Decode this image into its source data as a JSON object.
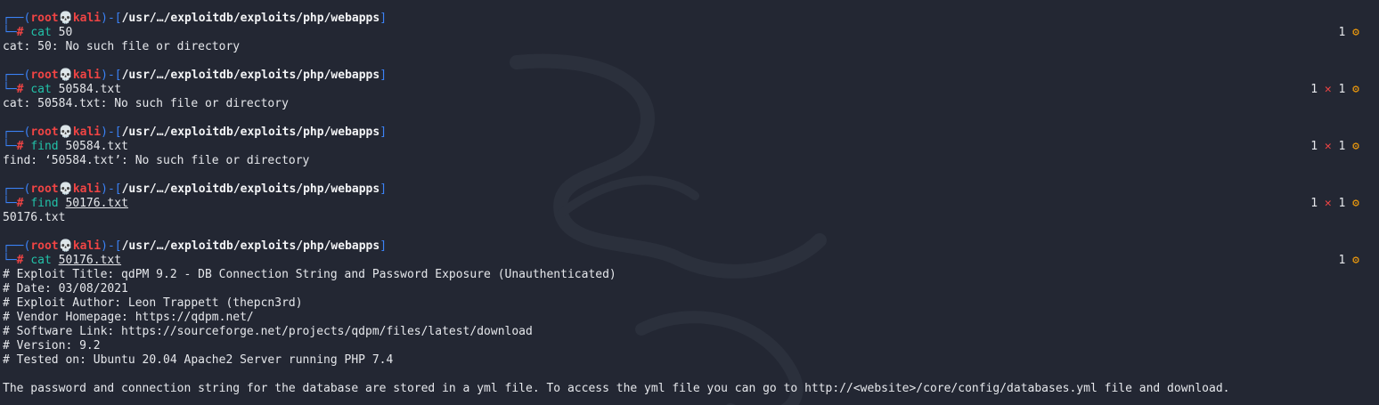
{
  "prompt": {
    "user": "root",
    "skull": "💀",
    "host": "kali",
    "path": "/usr/…/exploitdb/exploits/php/webapps",
    "hash": "#"
  },
  "colors": {
    "background": "#232733",
    "prompt_frame": "#3b82f6",
    "prompt_user": "#ef4444",
    "command": "#22c1a8",
    "error_x": "#ef4444",
    "gear": "#f59e0b"
  },
  "blocks": [
    {
      "command": "cat",
      "argument": "50",
      "status": {
        "left": "",
        "x": "",
        "right": "1",
        "gear": "⚙"
      },
      "output": [
        "cat: 50: No such file or directory"
      ]
    },
    {
      "command": "cat",
      "argument": "50584.txt",
      "status": {
        "left": "1",
        "x": "✕",
        "right": "1",
        "gear": "⚙"
      },
      "output": [
        "cat: 50584.txt: No such file or directory"
      ]
    },
    {
      "command": "find",
      "argument": "50584.txt",
      "status": {
        "left": "1",
        "x": "✕",
        "right": "1",
        "gear": "⚙"
      },
      "output": [
        "find: ‘50584.txt’: No such file or directory"
      ]
    },
    {
      "command": "find",
      "argument": "50176.txt",
      "status": {
        "left": "1",
        "x": "✕",
        "right": "1",
        "gear": "⚙"
      },
      "output": [
        "50176.txt"
      ]
    },
    {
      "command": "cat",
      "argument": "50176.txt",
      "status": {
        "left": "",
        "x": "",
        "right": "1",
        "gear": "⚙"
      },
      "output": [
        "# Exploit Title: qdPM 9.2 - DB Connection String and Password Exposure (Unauthenticated)",
        "# Date: 03/08/2021",
        "# Exploit Author: Leon Trappett (thepcn3rd)",
        "# Vendor Homepage: https://qdpm.net/",
        "# Software Link: https://sourceforge.net/projects/qdpm/files/latest/download",
        "# Version: 9.2",
        "# Tested on: Ubuntu 20.04 Apache2 Server running PHP 7.4",
        "",
        "The password and connection string for the database are stored in a yml file. To access the yml file you can go to http://<website>/core/config/databases.yml file and download."
      ]
    }
  ]
}
